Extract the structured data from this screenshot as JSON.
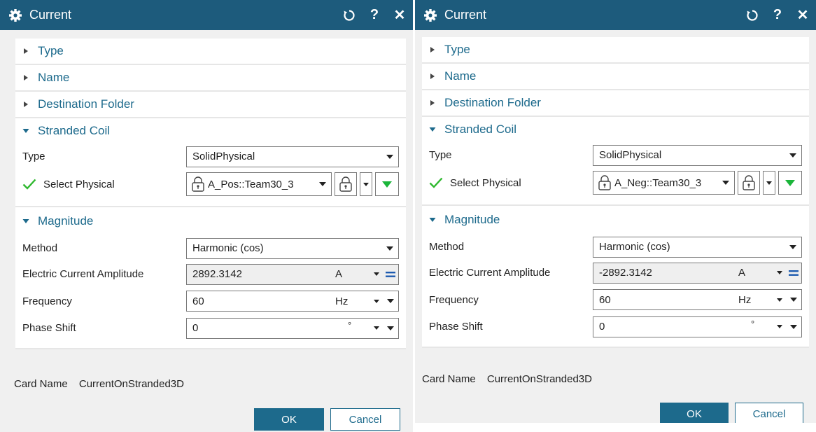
{
  "dialogs": [
    {
      "title": "Current",
      "sections": {
        "type": "Type",
        "name": "Name",
        "destination": "Destination Folder",
        "stranded": "Stranded Coil",
        "magnitude": "Magnitude"
      },
      "stranded": {
        "type_label": "Type",
        "type_value": "SolidPhysical",
        "select_label": "Select Physical",
        "select_value": "A_Pos::Team30_3"
      },
      "magnitude": {
        "method_label": "Method",
        "method_value": "Harmonic (cos)",
        "amp_label": "Electric Current Amplitude",
        "amp_value": "2892.3142",
        "amp_unit": "A",
        "freq_label": "Frequency",
        "freq_value": "60",
        "freq_unit": "Hz",
        "phase_label": "Phase Shift",
        "phase_value": "0",
        "phase_unit": "°"
      },
      "card_label": "Card Name",
      "card_value": "CurrentOnStranded3D",
      "ok": "OK",
      "cancel": "Cancel"
    },
    {
      "title": "Current",
      "sections": {
        "type": "Type",
        "name": "Name",
        "destination": "Destination Folder",
        "stranded": "Stranded Coil",
        "magnitude": "Magnitude"
      },
      "stranded": {
        "type_label": "Type",
        "type_value": "SolidPhysical",
        "select_label": "Select Physical",
        "select_value": "A_Neg::Team30_3"
      },
      "magnitude": {
        "method_label": "Method",
        "method_value": "Harmonic (cos)",
        "amp_label": "Electric Current Amplitude",
        "amp_value": "-2892.3142",
        "amp_unit": "A",
        "freq_label": "Frequency",
        "freq_value": "60",
        "freq_unit": "Hz",
        "phase_label": "Phase Shift",
        "phase_value": "0",
        "phase_unit": "°"
      },
      "card_label": "Card Name",
      "card_value": "CurrentOnStranded3D",
      "ok": "OK",
      "cancel": "Cancel"
    }
  ],
  "icons": {
    "settings": "gear-icon",
    "reset": "reset-icon",
    "help": "help-icon",
    "close": "close-icon",
    "lock": "lock-icon",
    "check": "check-icon"
  },
  "colors": {
    "titlebar": "#1d5b7c",
    "accent": "#1d6a8c",
    "check": "#2eb82e",
    "green_arrow": "#1bb53a"
  }
}
